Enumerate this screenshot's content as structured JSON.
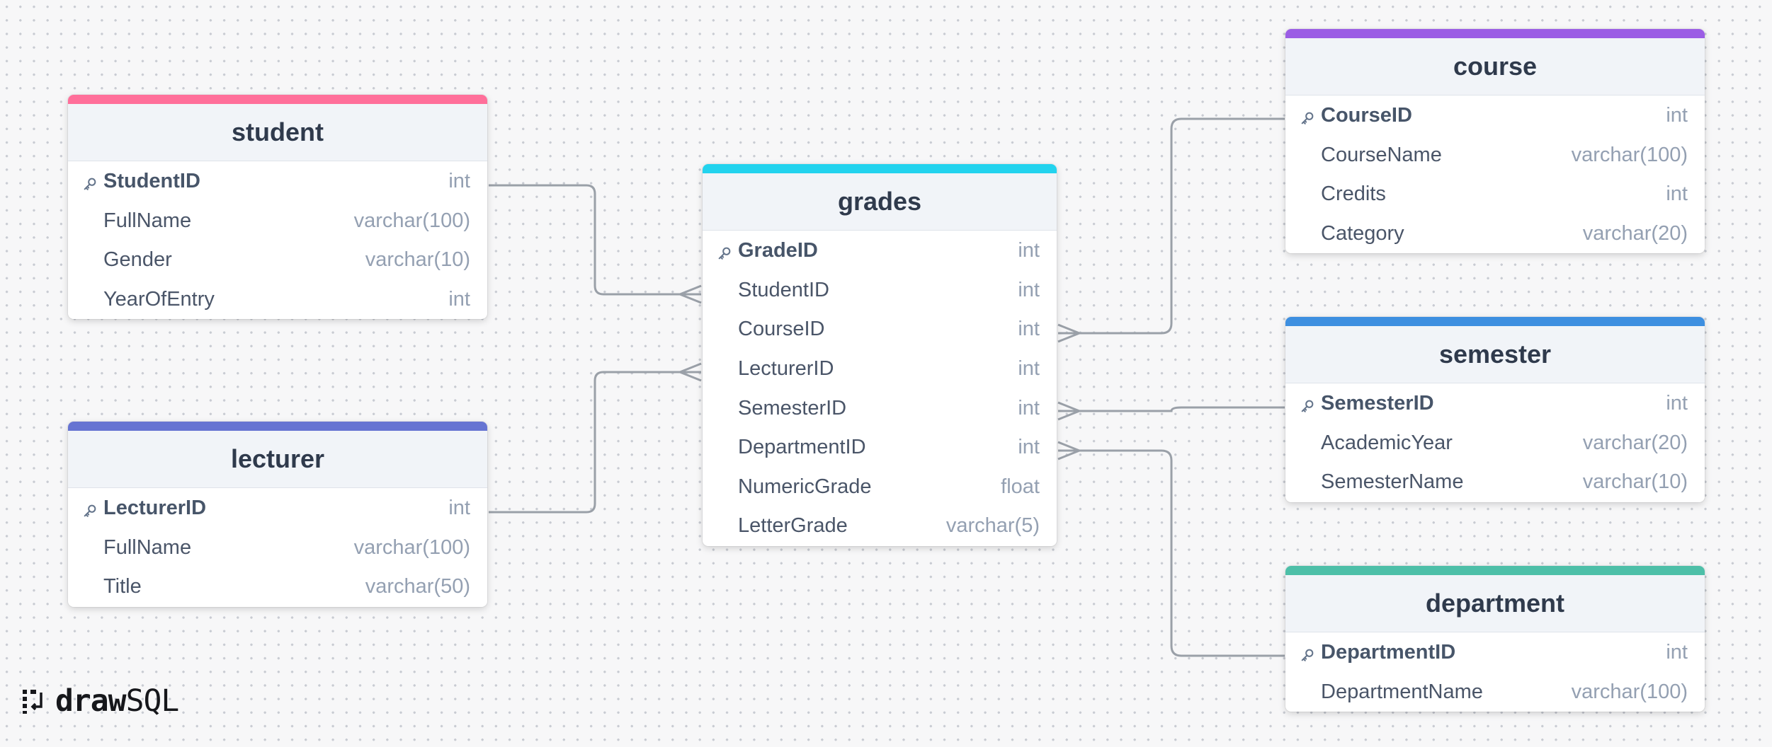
{
  "tables": {
    "student": {
      "title": "student",
      "accent": "#ff6f9a",
      "fields": [
        {
          "name": "StudentID",
          "type": "int",
          "pk": true
        },
        {
          "name": "FullName",
          "type": "varchar(100)"
        },
        {
          "name": "Gender",
          "type": "varchar(10)"
        },
        {
          "name": "YearOfEntry",
          "type": "int"
        }
      ]
    },
    "lecturer": {
      "title": "lecturer",
      "accent": "#6674d2",
      "fields": [
        {
          "name": "LecturerID",
          "type": "int",
          "pk": true
        },
        {
          "name": "FullName",
          "type": "varchar(100)"
        },
        {
          "name": "Title",
          "type": "varchar(50)"
        }
      ]
    },
    "grades": {
      "title": "grades",
      "accent": "#22d3ee",
      "fields": [
        {
          "name": "GradeID",
          "type": "int",
          "pk": true
        },
        {
          "name": "StudentID",
          "type": "int"
        },
        {
          "name": "CourseID",
          "type": "int"
        },
        {
          "name": "LecturerID",
          "type": "int"
        },
        {
          "name": "SemesterID",
          "type": "int"
        },
        {
          "name": "DepartmentID",
          "type": "int"
        },
        {
          "name": "NumericGrade",
          "type": "float"
        },
        {
          "name": "LetterGrade",
          "type": "varchar(5)"
        }
      ]
    },
    "course": {
      "title": "course",
      "accent": "#9b5de5",
      "fields": [
        {
          "name": "CourseID",
          "type": "int",
          "pk": true
        },
        {
          "name": "CourseName",
          "type": "varchar(100)"
        },
        {
          "name": "Credits",
          "type": "int"
        },
        {
          "name": "Category",
          "type": "varchar(20)"
        }
      ]
    },
    "semester": {
      "title": "semester",
      "accent": "#3d8fe0",
      "fields": [
        {
          "name": "SemesterID",
          "type": "int",
          "pk": true
        },
        {
          "name": "AcademicYear",
          "type": "varchar(20)"
        },
        {
          "name": "SemesterName",
          "type": "varchar(10)"
        }
      ]
    },
    "department": {
      "title": "department",
      "accent": "#4dbfa8",
      "fields": [
        {
          "name": "DepartmentID",
          "type": "int",
          "pk": true
        },
        {
          "name": "DepartmentName",
          "type": "varchar(100)"
        }
      ]
    }
  },
  "relations": [
    {
      "from": "student.StudentID",
      "to": "grades.StudentID",
      "cardinality": "one-to-many"
    },
    {
      "from": "lecturer.LecturerID",
      "to": "grades.LecturerID",
      "cardinality": "one-to-many"
    },
    {
      "from": "course.CourseID",
      "to": "grades.CourseID",
      "cardinality": "one-to-many"
    },
    {
      "from": "semester.SemesterID",
      "to": "grades.SemesterID",
      "cardinality": "one-to-many"
    },
    {
      "from": "department.DepartmentID",
      "to": "grades.DepartmentID",
      "cardinality": "one-to-many"
    }
  ],
  "logo": {
    "part1": "draw",
    "part2": "SQL",
    "icon": "drawsql-logo-icon"
  },
  "colors": {
    "connector": "#9aa0a8",
    "background": "#f7f7f8"
  }
}
